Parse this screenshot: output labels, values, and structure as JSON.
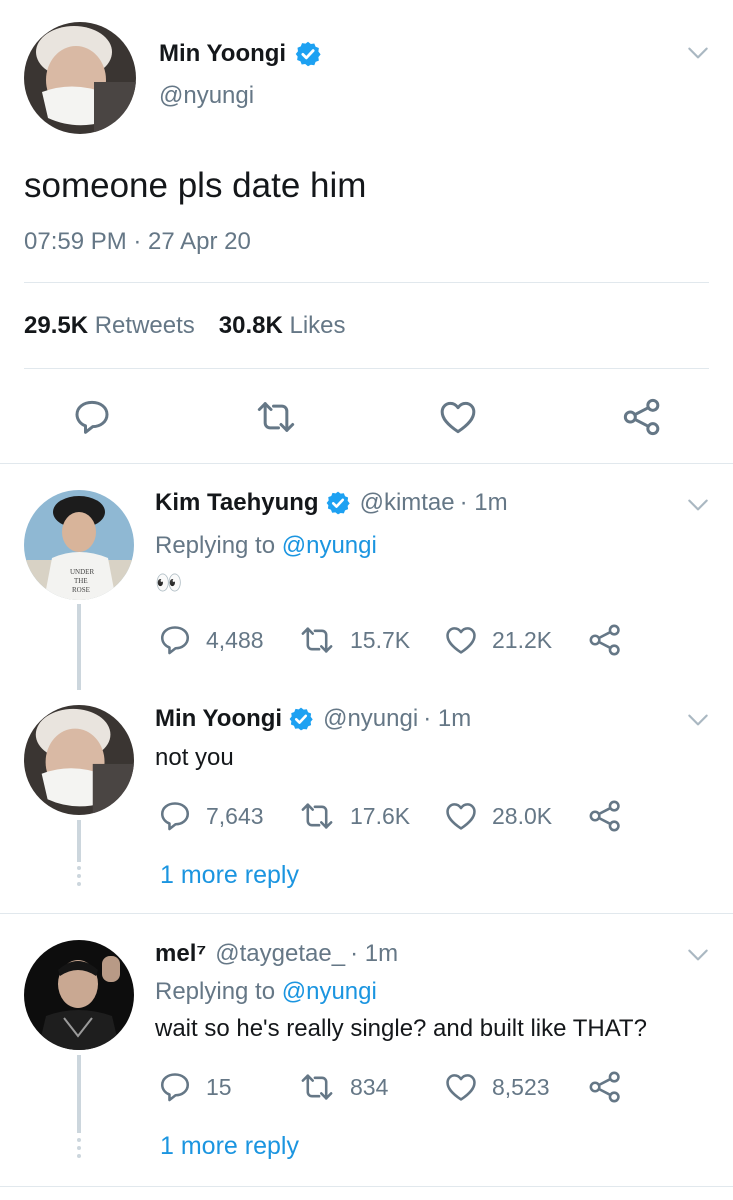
{
  "main_tweet": {
    "display_name": "Min Yoongi",
    "handle": "@nyungi",
    "text": "someone pls date him",
    "timestamp": "07:59 PM · 27 Apr 20",
    "retweets_count": "29.5K",
    "retweets_label": "Retweets",
    "likes_count": "30.8K",
    "likes_label": "Likes"
  },
  "replies": [
    {
      "display_name": "Kim Taehyung",
      "handle": "@kimtae",
      "time": "· 1m",
      "replying_prefix": "Replying to",
      "replying_to": "@nyungi",
      "text": "👀",
      "replies": "4,488",
      "retweets": "15.7K",
      "likes": "21.2K",
      "avatar_text": "UNDER THE ROSE",
      "verified": true
    },
    {
      "display_name": "Min Yoongi",
      "handle": "@nyungi",
      "time": "· 1m",
      "text": "not you",
      "replies": "7,643",
      "retweets": "17.6K",
      "likes": "28.0K",
      "verified": true
    },
    {
      "display_name": "mel⁷",
      "handle": "@taygetae_",
      "time": "· 1m",
      "replying_prefix": "Replying to",
      "replying_to": "@nyungi",
      "text": "wait so he's really single? and built like THAT?",
      "replies": "15",
      "retweets": "834",
      "likes": "8,523",
      "verified": false
    }
  ],
  "more_replies_label": "1 more reply",
  "colors": {
    "verified": "#1da1f2",
    "link": "#1b95e0",
    "secondary_text": "#657786",
    "divider": "#e1e8ed",
    "thread_line": "#ccd6dd"
  },
  "icons": [
    "verified-badge-icon",
    "chevron-down-icon",
    "reply-icon",
    "retweet-icon",
    "like-icon",
    "share-icon"
  ]
}
